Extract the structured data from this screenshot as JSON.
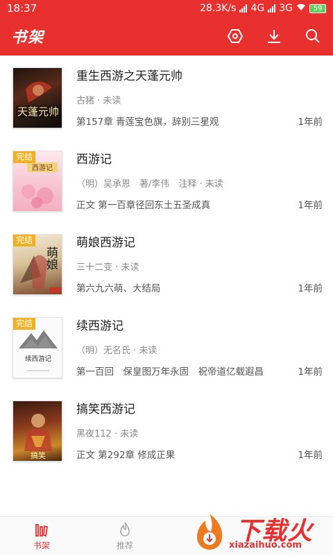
{
  "status_bar": {
    "time": "18:37",
    "speed": "28.3K/s",
    "net1": "4G",
    "net2": "3G",
    "battery": "59"
  },
  "app_bar": {
    "title": "书架",
    "icons": [
      "settings-hex-icon",
      "download-icon",
      "search-icon"
    ]
  },
  "books": [
    {
      "title": "重生西游之天蓬元帅",
      "meta": "古猪 · 未读",
      "chapter": "第157章 青莲宝色旗，辞别三星观",
      "time": "1年前",
      "completed": false,
      "cover_title": "天蓬元帅"
    },
    {
      "title": "西游记",
      "meta": "（明）吴承恩　著/李伟　注释 · 未读",
      "chapter": "正文 第一百章径回东土五圣成真",
      "time": "1年前",
      "completed": true,
      "cover_title": "西游记"
    },
    {
      "title": "萌娘西游记",
      "meta": "三十二变 · 未读",
      "chapter": "第六九六萌、大结局",
      "time": "1年前",
      "completed": true,
      "cover_title": "萌娘"
    },
    {
      "title": "续西游记",
      "meta": "（明）无名氏 · 未读",
      "chapter": "第一百回　保皇图万年永固　祝帝道亿载遐昌",
      "time": "1年前",
      "completed": true,
      "cover_title": "续西游记"
    },
    {
      "title": "搞笑西游记",
      "meta": "黑夜112 · 未读",
      "chapter": "正文 第292章 修成正果",
      "time": "1年前",
      "completed": false,
      "cover_title": "搞笑"
    }
  ],
  "badge_label": "完结",
  "bottom_nav": {
    "shelf": "书架",
    "recommend": "推荐"
  },
  "watermark": {
    "brand": "下载火",
    "url": "xiazaihuo.com"
  }
}
